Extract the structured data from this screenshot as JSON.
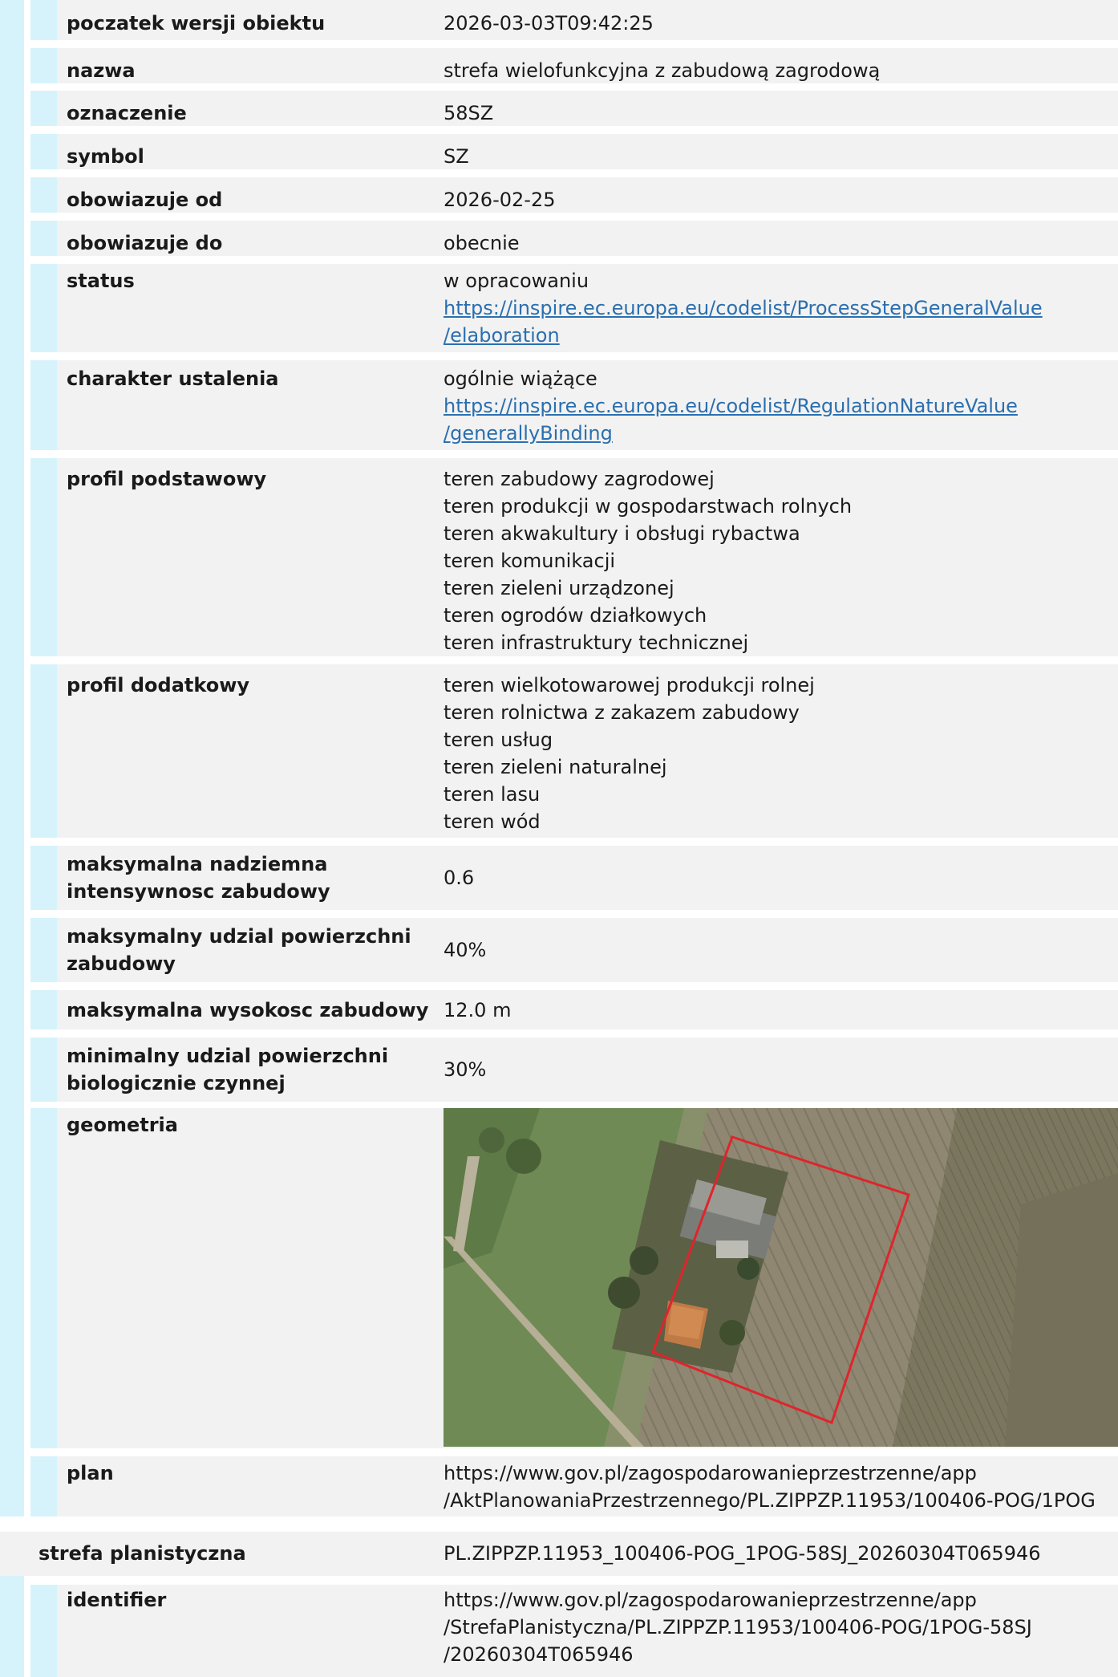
{
  "rows": [
    {
      "label": "poczatek wersji obiektu",
      "lines": [
        "2026-03-03T09:42:25"
      ]
    },
    {
      "label": "nazwa",
      "lines": [
        "strefa wielofunkcyjna z zabudową zagrodową"
      ]
    },
    {
      "label": "oznaczenie",
      "lines": [
        "58SZ"
      ]
    },
    {
      "label": "symbol",
      "lines": [
        "SZ"
      ]
    },
    {
      "label": "obowiazuje od",
      "lines": [
        "2026-02-25"
      ]
    },
    {
      "label": "obowiazuje do",
      "lines": [
        "obecnie"
      ]
    },
    {
      "label": "status",
      "lines": [
        "w opracowaniu"
      ],
      "link": [
        "https://inspire.ec.europa.eu/codelist/ProcessStepGeneralValue",
        "/elaboration"
      ]
    },
    {
      "label": "charakter ustalenia",
      "lines": [
        "ogólnie wiążące"
      ],
      "link": [
        "https://inspire.ec.europa.eu/codelist/RegulationNatureValue",
        "/generallyBinding"
      ]
    },
    {
      "label": "profil podstawowy",
      "lines": [
        "teren zabudowy zagrodowej",
        "teren produkcji w gospodarstwach rolnych",
        "teren akwakultury i obsługi rybactwa",
        "teren komunikacji",
        "teren zieleni urządzonej",
        "teren ogrodów działkowych",
        "teren infrastruktury technicznej"
      ]
    },
    {
      "label": "profil dodatkowy",
      "lines": [
        "teren wielkotowarowej produkcji rolnej",
        "teren rolnictwa z zakazem zabudowy",
        "teren usług",
        "teren zieleni naturalnej",
        "teren lasu",
        "teren wód"
      ]
    },
    {
      "label": "maksymalna nadziemna intensywnosc zabudowy",
      "label_lines": [
        "maksymalna nadziemna",
        "intensywnosc zabudowy"
      ],
      "lines": [
        "0.6"
      ]
    },
    {
      "label": "maksymalny udzial powierzchni zabudowy",
      "label_lines": [
        "maksymalny udzial powierzchni",
        "zabudowy"
      ],
      "lines": [
        "40%"
      ]
    },
    {
      "label": "maksymalna wysokosc zabudowy",
      "lines": [
        "12.0 m"
      ]
    },
    {
      "label": "minimalny udzial powierzchni biologicznie czynnej",
      "label_lines": [
        "minimalny udzial powierzchni",
        "biologicznie czynnej"
      ],
      "lines": [
        "30%"
      ]
    },
    {
      "label": "geometria"
    },
    {
      "label": "plan",
      "lines": [
        "https://www.gov.pl/zagospodarowanieprzestrzenne/app",
        "/AktPlanowaniaPrzestrzennego/PL.ZIPPZP.11953/100406-POG/1POG"
      ]
    }
  ],
  "strefa": {
    "label": "strefa planistyczna",
    "value": "PL.ZIPPZP.11953_100406-POG_1POG-58SJ_20260304T065946"
  },
  "identifier": {
    "label": "identifier",
    "lines": [
      "https://www.gov.pl/zagospodarowanieprzestrzenne/app",
      "/StrefaPlanistyczna/PL.ZIPPZP.11953/100406-POG/1POG-58SJ",
      "/20260304T065946"
    ]
  },
  "colors": {
    "side_bar": "#d6f3fb",
    "row_bg": "#f2f2f2",
    "link": "#2a6fb0",
    "boundary": "#e0242b"
  }
}
